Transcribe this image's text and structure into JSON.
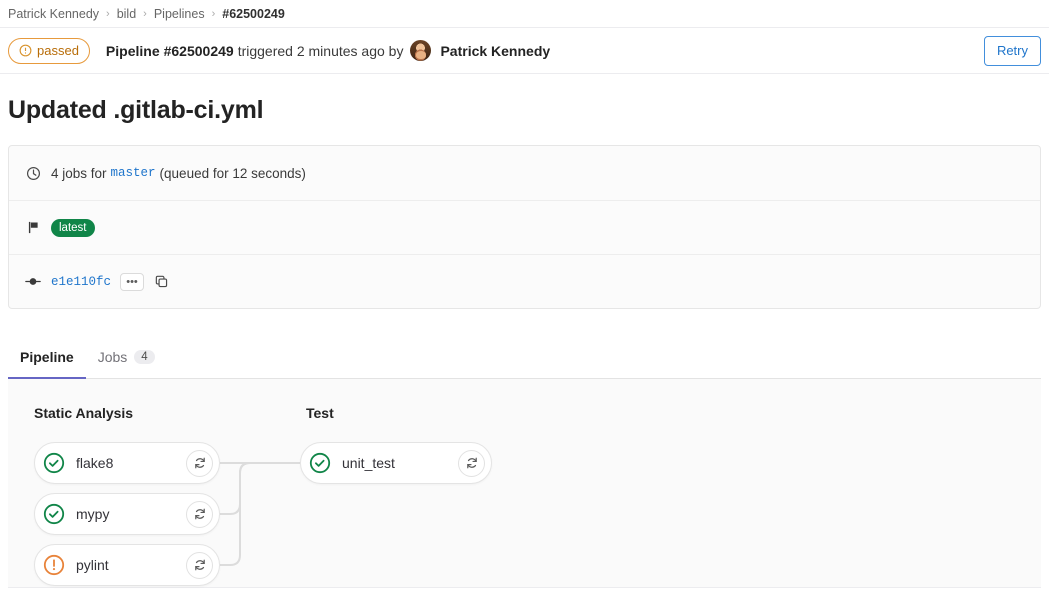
{
  "breadcrumb": {
    "items": [
      {
        "label": "Patrick Kennedy",
        "current": false
      },
      {
        "label": "bild",
        "current": false
      },
      {
        "label": "Pipelines",
        "current": false
      },
      {
        "label": "#62500249",
        "current": true
      }
    ],
    "separator": "›"
  },
  "header": {
    "status": {
      "label": "passed",
      "icon": "warning-circle-icon",
      "color": "#b86d09",
      "border_color": "#e79a3c"
    },
    "prefix": "Pipeline",
    "pipeline_id": "#62500249",
    "triggered_text": "triggered 2 minutes ago by",
    "user_name": "Patrick Kennedy",
    "retry_label": "Retry",
    "retry_color": "#1f75cb"
  },
  "page_title": "Updated .gitlab-ci.yml",
  "info_card": {
    "jobs_row": {
      "icon": "clock-icon",
      "prefix": "4 jobs for",
      "ref": "master",
      "suffix": "(queued for 12 seconds)"
    },
    "tag_row": {
      "icon": "flag-icon",
      "tag": "latest",
      "tag_color": "#108548"
    },
    "commit_row": {
      "icon": "commit-icon",
      "sha": "e1e110fc",
      "more_label": "•••",
      "copy_icon": "copy-icon"
    }
  },
  "tabs": [
    {
      "label": "Pipeline",
      "count": null,
      "active": true
    },
    {
      "label": "Jobs",
      "count": "4",
      "active": false
    }
  ],
  "graph": {
    "stages": [
      {
        "name": "Static Analysis"
      },
      {
        "name": "Test"
      }
    ],
    "jobs": [
      {
        "name": "flake8",
        "status": "success",
        "stage": 0,
        "retry_icon": "retry-icon"
      },
      {
        "name": "mypy",
        "status": "success",
        "stage": 0,
        "retry_icon": "retry-icon"
      },
      {
        "name": "pylint",
        "status": "warning",
        "stage": 0,
        "retry_icon": "retry-icon"
      },
      {
        "name": "unit_test",
        "status": "success",
        "stage": 1,
        "retry_icon": "retry-icon"
      }
    ],
    "status_colors": {
      "success": "#108548",
      "warning": "#e8833a"
    }
  }
}
